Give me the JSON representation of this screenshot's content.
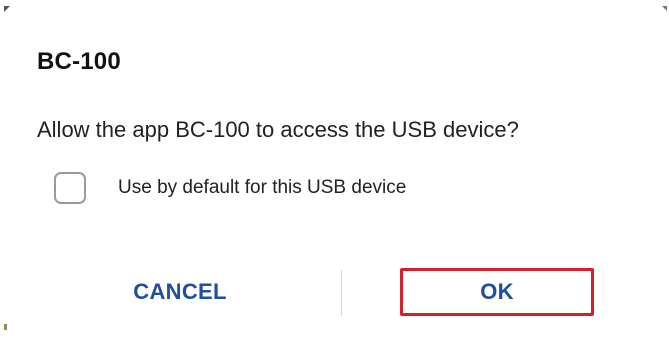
{
  "dialog": {
    "title": "BC-100",
    "message": "Allow the app BC-100 to access the USB device?",
    "checkbox": {
      "label": "Use by default for this USB device",
      "checked": false
    },
    "buttons": {
      "cancel_label": "CANCEL",
      "ok_label": "OK"
    }
  },
  "colors": {
    "button_text": "#1f4fa0",
    "highlight_border": "#d3212a",
    "background": "#ffffff"
  }
}
